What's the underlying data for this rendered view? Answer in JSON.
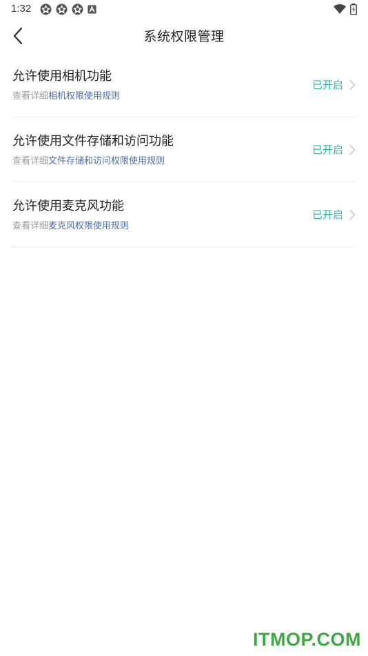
{
  "status_bar": {
    "time": "1:32",
    "left_icons": [
      "app-notification-icon",
      "app-notification-icon",
      "app-notification-icon",
      "a-notification-icon"
    ],
    "right_icons": [
      "wifi-icon",
      "battery-icon"
    ]
  },
  "header": {
    "title": "系统权限管理",
    "back_icon": "chevron-left-icon"
  },
  "permissions": [
    {
      "title": "允许使用相机功能",
      "desc_prefix": "查看详细",
      "desc_link": "相机权限使用规则",
      "status": "已开启"
    },
    {
      "title": "允许使用文件存储和访问功能",
      "desc_prefix": "查看详细",
      "desc_link": "文件存储和访问权限使用规则",
      "status": "已开启"
    },
    {
      "title": "允许使用麦克风功能",
      "desc_prefix": "查看详细",
      "desc_link": "麦克风权限使用规则",
      "status": "已开启"
    }
  ],
  "watermark": "ITMOP.COM",
  "colors": {
    "accent": "#2bb5a8",
    "link": "#4a6da8",
    "watermark": "#3fa845"
  }
}
